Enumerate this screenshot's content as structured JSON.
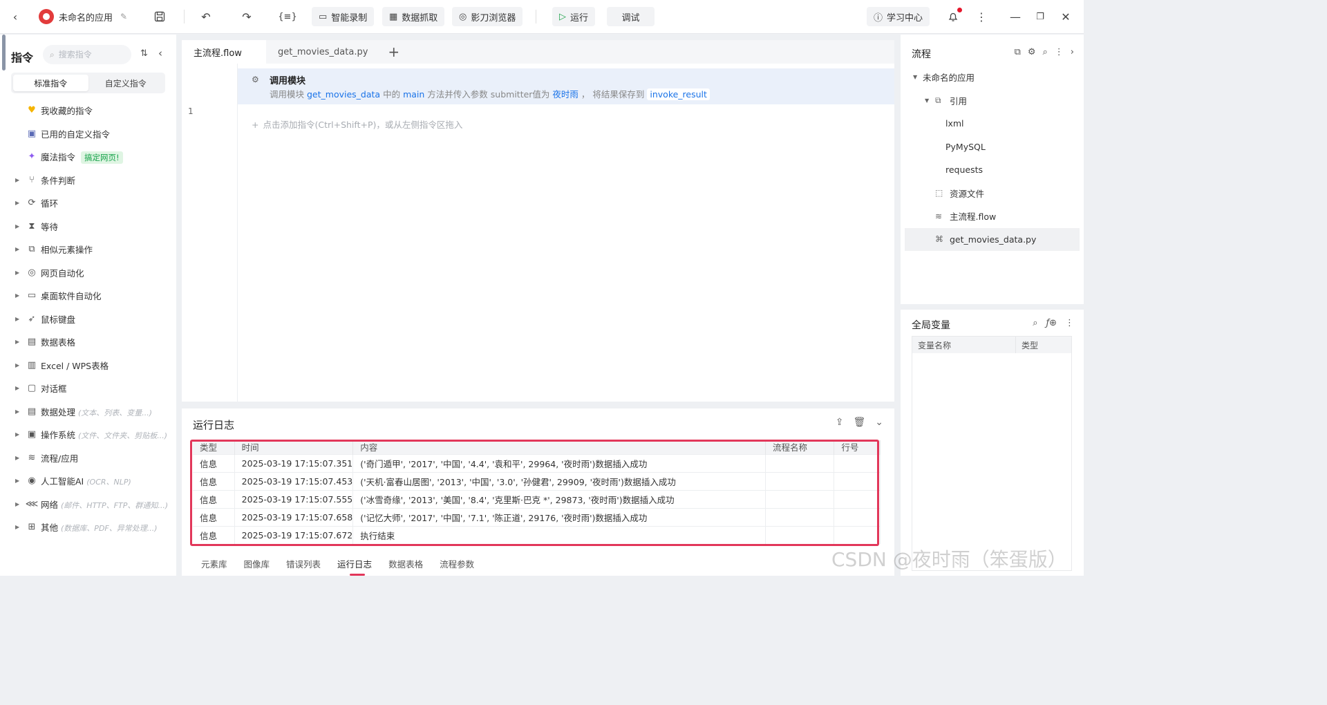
{
  "toolbar": {
    "app_name": "未命名的应用",
    "buttons": {
      "smart_record": "智能录制",
      "data_capture": "数据抓取",
      "browser": "影刀浏览器",
      "run": "运行",
      "debug": "调试",
      "learning_center": "学习中心"
    }
  },
  "left_panel": {
    "title": "指令",
    "search_placeholder": "搜索指令",
    "tabs": [
      "标准指令",
      "自定义指令"
    ],
    "items": [
      {
        "label": "我收藏的指令",
        "icon": "heart-icon",
        "expandable": false
      },
      {
        "label": "已用的自定义指令",
        "icon": "calendar-icon",
        "expandable": false
      },
      {
        "label": "魔法指令",
        "icon": "sparkle-icon",
        "expandable": false,
        "badge": "搞定网页!"
      },
      {
        "label": "条件判断",
        "icon": "branch-icon",
        "expandable": true
      },
      {
        "label": "循环",
        "icon": "loop-icon",
        "expandable": true
      },
      {
        "label": "等待",
        "icon": "hourglass-icon",
        "expandable": true
      },
      {
        "label": "相似元素操作",
        "icon": "copy-icon",
        "expandable": true
      },
      {
        "label": "网页自动化",
        "icon": "browser-icon",
        "expandable": true
      },
      {
        "label": "桌面软件自动化",
        "icon": "monitor-icon",
        "expandable": true
      },
      {
        "label": "鼠标键盘",
        "icon": "cursor-icon",
        "expandable": true
      },
      {
        "label": "数据表格",
        "icon": "document-icon",
        "expandable": true
      },
      {
        "label": "Excel / WPS表格",
        "icon": "excel-icon",
        "expandable": true
      },
      {
        "label": "对话框",
        "icon": "dialog-icon",
        "expandable": true
      },
      {
        "label": "数据处理",
        "icon": "data-icon",
        "expandable": true,
        "hint": "(文本、列表、变量...)"
      },
      {
        "label": "操作系统",
        "icon": "briefcase-icon",
        "expandable": true,
        "hint": "(文件、文件夹、剪贴板...)"
      },
      {
        "label": "流程/应用",
        "icon": "layers-icon",
        "expandable": true
      },
      {
        "label": "人工智能AI",
        "icon": "ai-icon",
        "expandable": true,
        "hint": "(OCR、NLP)"
      },
      {
        "label": "网络",
        "icon": "share-icon",
        "expandable": true,
        "hint": "(邮件、HTTP、FTP、群通知...)"
      },
      {
        "label": "其他",
        "icon": "grid-icon",
        "expandable": true,
        "hint": "(数据库、PDF、异常处理...)"
      }
    ]
  },
  "editor": {
    "tabs": [
      "主流程.flow",
      "get_movies_data.py"
    ],
    "step": {
      "line": "1",
      "title": "调用模块",
      "desc_prefix": "调用模块",
      "module": "get_movies_data",
      "mid1": "中的",
      "method": "main",
      "mid2": "方法并传入参数 submitter值为",
      "param_value": "夜时雨",
      "mid3": "， 将结果保存到",
      "result_var": "invoke_result"
    },
    "add_hint": "点击添加指令(Ctrl+Shift+P)，或从左侧指令区拖入"
  },
  "log": {
    "title": "运行日志",
    "columns": [
      "类型",
      "时间",
      "内容",
      "流程名称",
      "行号"
    ],
    "rows": [
      {
        "type": "信息",
        "time": "2025-03-19 17:15:07.351",
        "content": "('奇门遁甲', '2017', '中国', '4.4', '袁和平', 29964, '夜时雨')数据插入成功",
        "flow": "",
        "line": ""
      },
      {
        "type": "信息",
        "time": "2025-03-19 17:15:07.453",
        "content": "('天机·富春山居图', '2013', '中国', '3.0', '孙健君', 29909, '夜时雨')数据插入成功",
        "flow": "",
        "line": ""
      },
      {
        "type": "信息",
        "time": "2025-03-19 17:15:07.555",
        "content": "('冰雪奇缘', '2013', '美国', '8.4', '克里斯·巴克 *', 29873, '夜时雨')数据插入成功",
        "flow": "",
        "line": ""
      },
      {
        "type": "信息",
        "time": "2025-03-19 17:15:07.658",
        "content": "('记忆大师', '2017', '中国', '7.1', '陈正道', 29176, '夜时雨')数据插入成功",
        "flow": "",
        "line": ""
      },
      {
        "type": "信息",
        "time": "2025-03-19 17:15:07.672",
        "content": "执行结束",
        "flow": "",
        "line": ""
      }
    ],
    "bottom_tabs": [
      "元素库",
      "图像库",
      "错误列表",
      "运行日志",
      "数据表格",
      "流程参数"
    ],
    "active_bottom_tab": "运行日志"
  },
  "right_panel": {
    "title": "流程",
    "tree": [
      {
        "label": "未命名的应用",
        "level": 0,
        "twisty": true,
        "icon": ""
      },
      {
        "label": "引用",
        "level": 1,
        "twisty": true,
        "icon": "reference-icon"
      },
      {
        "label": "lxml",
        "level": 2,
        "twisty": false,
        "icon": ""
      },
      {
        "label": "PyMySQL",
        "level": 2,
        "twisty": false,
        "icon": ""
      },
      {
        "label": "requests",
        "level": 2,
        "twisty": false,
        "icon": ""
      },
      {
        "label": "资源文件",
        "level": 1,
        "twisty": false,
        "icon": "folder-icon"
      },
      {
        "label": "主流程.flow",
        "level": 1,
        "twisty": false,
        "icon": "layers-icon"
      },
      {
        "label": "get_movies_data.py",
        "level": 1,
        "twisty": false,
        "icon": "python-icon",
        "selected": true
      }
    ]
  },
  "vars_panel": {
    "title": "全局变量",
    "columns": [
      "变量名称",
      "类型"
    ]
  },
  "watermark": "CSDN @夜时雨（笨蛋版）",
  "colors": {
    "accent_blue": "#1a73e8",
    "highlight_red": "#e2375a",
    "run_green": "#1fa34a"
  }
}
